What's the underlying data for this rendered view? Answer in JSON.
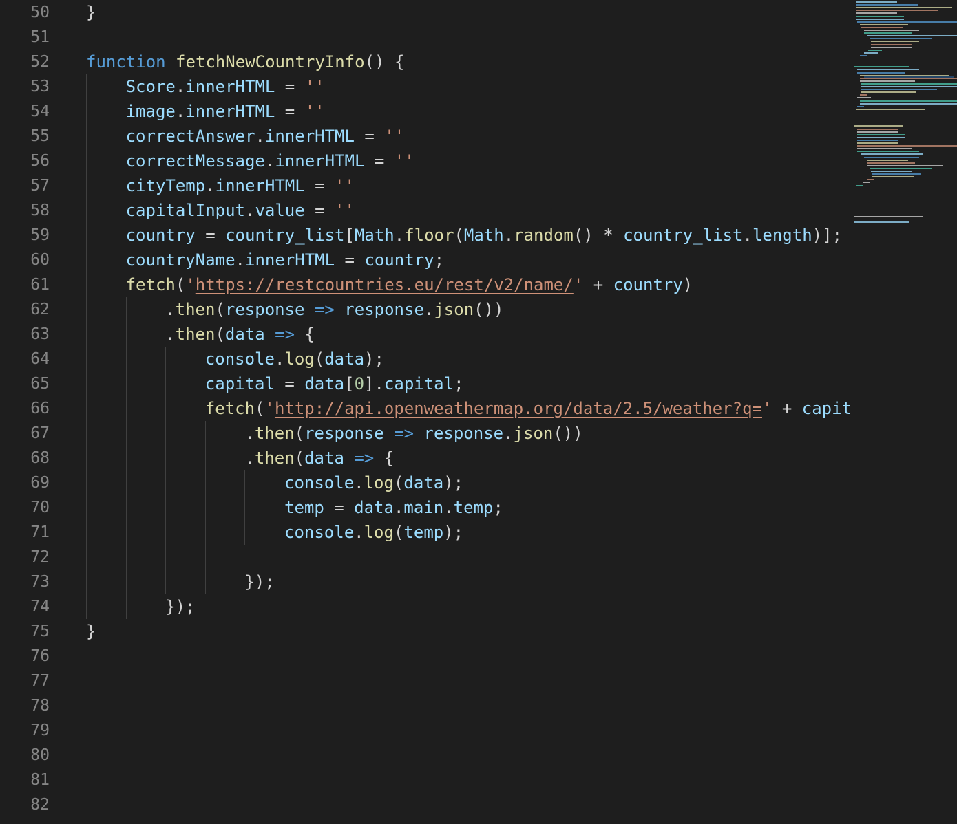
{
  "editor": {
    "colors": {
      "background": "#1e1e1e",
      "line_number": "#858585",
      "default": "#d4d4d4",
      "keyword": "#569cd6",
      "function": "#dcdcaa",
      "variable": "#9cdcfe",
      "string": "#ce9178",
      "number": "#b5cea8",
      "class": "#4ec9b0",
      "indent_guide": "#404040"
    },
    "lines": [
      {
        "number": "50",
        "indent": 0,
        "tokens": [
          {
            "t": "}",
            "c": "default"
          }
        ]
      },
      {
        "number": "51",
        "indent": 0,
        "tokens": []
      },
      {
        "number": "52",
        "indent": 0,
        "tokens": [
          {
            "t": "function",
            "c": "keyword"
          },
          {
            "t": " ",
            "c": "default"
          },
          {
            "t": "fetchNewCountryInfo",
            "c": "function"
          },
          {
            "t": "() {",
            "c": "default"
          }
        ]
      },
      {
        "number": "53",
        "indent": 1,
        "tokens": [
          {
            "t": "Score",
            "c": "variable"
          },
          {
            "t": ".",
            "c": "default"
          },
          {
            "t": "innerHTML",
            "c": "variable"
          },
          {
            "t": " = ",
            "c": "default"
          },
          {
            "t": "''",
            "c": "string"
          }
        ]
      },
      {
        "number": "54",
        "indent": 1,
        "tokens": [
          {
            "t": "image",
            "c": "variable"
          },
          {
            "t": ".",
            "c": "default"
          },
          {
            "t": "innerHTML",
            "c": "variable"
          },
          {
            "t": " = ",
            "c": "default"
          },
          {
            "t": "''",
            "c": "string"
          }
        ]
      },
      {
        "number": "55",
        "indent": 1,
        "tokens": [
          {
            "t": "correctAnswer",
            "c": "variable"
          },
          {
            "t": ".",
            "c": "default"
          },
          {
            "t": "innerHTML",
            "c": "variable"
          },
          {
            "t": " = ",
            "c": "default"
          },
          {
            "t": "''",
            "c": "string"
          }
        ]
      },
      {
        "number": "56",
        "indent": 1,
        "tokens": [
          {
            "t": "correctMessage",
            "c": "variable"
          },
          {
            "t": ".",
            "c": "default"
          },
          {
            "t": "innerHTML",
            "c": "variable"
          },
          {
            "t": " = ",
            "c": "default"
          },
          {
            "t": "''",
            "c": "string"
          }
        ]
      },
      {
        "number": "57",
        "indent": 1,
        "tokens": [
          {
            "t": "cityTemp",
            "c": "variable"
          },
          {
            "t": ".",
            "c": "default"
          },
          {
            "t": "innerHTML",
            "c": "variable"
          },
          {
            "t": " = ",
            "c": "default"
          },
          {
            "t": "''",
            "c": "string"
          }
        ]
      },
      {
        "number": "58",
        "indent": 1,
        "tokens": [
          {
            "t": "capitalInput",
            "c": "variable"
          },
          {
            "t": ".",
            "c": "default"
          },
          {
            "t": "value",
            "c": "variable"
          },
          {
            "t": " = ",
            "c": "default"
          },
          {
            "t": "''",
            "c": "string"
          }
        ]
      },
      {
        "number": "59",
        "indent": 1,
        "tokens": [
          {
            "t": "country",
            "c": "variable"
          },
          {
            "t": " = ",
            "c": "default"
          },
          {
            "t": "country_list",
            "c": "variable"
          },
          {
            "t": "[",
            "c": "default"
          },
          {
            "t": "Math",
            "c": "variable"
          },
          {
            "t": ".",
            "c": "default"
          },
          {
            "t": "floor",
            "c": "function"
          },
          {
            "t": "(",
            "c": "default"
          },
          {
            "t": "Math",
            "c": "variable"
          },
          {
            "t": ".",
            "c": "default"
          },
          {
            "t": "random",
            "c": "function"
          },
          {
            "t": "() * ",
            "c": "default"
          },
          {
            "t": "country_list",
            "c": "variable"
          },
          {
            "t": ".",
            "c": "default"
          },
          {
            "t": "length",
            "c": "variable"
          },
          {
            "t": ")];",
            "c": "default"
          }
        ]
      },
      {
        "number": "60",
        "indent": 1,
        "tokens": [
          {
            "t": "countryName",
            "c": "variable"
          },
          {
            "t": ".",
            "c": "default"
          },
          {
            "t": "innerHTML",
            "c": "variable"
          },
          {
            "t": " = ",
            "c": "default"
          },
          {
            "t": "country",
            "c": "variable"
          },
          {
            "t": ";",
            "c": "default"
          }
        ]
      },
      {
        "number": "61",
        "indent": 1,
        "tokens": [
          {
            "t": "fetch",
            "c": "function"
          },
          {
            "t": "(",
            "c": "default"
          },
          {
            "t": "'",
            "c": "string"
          },
          {
            "t": "https://restcountries.eu/rest/v2/name/",
            "c": "link"
          },
          {
            "t": "'",
            "c": "string"
          },
          {
            "t": " + ",
            "c": "default"
          },
          {
            "t": "country",
            "c": "variable"
          },
          {
            "t": ")",
            "c": "default"
          }
        ]
      },
      {
        "number": "62",
        "indent": 2,
        "tokens": [
          {
            "t": ".",
            "c": "default"
          },
          {
            "t": "then",
            "c": "function"
          },
          {
            "t": "(",
            "c": "default"
          },
          {
            "t": "response",
            "c": "variable"
          },
          {
            "t": " ",
            "c": "default"
          },
          {
            "t": "=>",
            "c": "keyword"
          },
          {
            "t": " ",
            "c": "default"
          },
          {
            "t": "response",
            "c": "variable"
          },
          {
            "t": ".",
            "c": "default"
          },
          {
            "t": "json",
            "c": "function"
          },
          {
            "t": "())",
            "c": "default"
          }
        ]
      },
      {
        "number": "63",
        "indent": 2,
        "tokens": [
          {
            "t": ".",
            "c": "default"
          },
          {
            "t": "then",
            "c": "function"
          },
          {
            "t": "(",
            "c": "default"
          },
          {
            "t": "data",
            "c": "variable"
          },
          {
            "t": " ",
            "c": "default"
          },
          {
            "t": "=>",
            "c": "keyword"
          },
          {
            "t": " {",
            "c": "default"
          }
        ]
      },
      {
        "number": "64",
        "indent": 3,
        "tokens": [
          {
            "t": "console",
            "c": "variable"
          },
          {
            "t": ".",
            "c": "default"
          },
          {
            "t": "log",
            "c": "function"
          },
          {
            "t": "(",
            "c": "default"
          },
          {
            "t": "data",
            "c": "variable"
          },
          {
            "t": ");",
            "c": "default"
          }
        ]
      },
      {
        "number": "65",
        "indent": 3,
        "tokens": [
          {
            "t": "capital",
            "c": "variable"
          },
          {
            "t": " = ",
            "c": "default"
          },
          {
            "t": "data",
            "c": "variable"
          },
          {
            "t": "[",
            "c": "default"
          },
          {
            "t": "0",
            "c": "number"
          },
          {
            "t": "].",
            "c": "default"
          },
          {
            "t": "capital",
            "c": "variable"
          },
          {
            "t": ";",
            "c": "default"
          }
        ]
      },
      {
        "number": "66",
        "indent": 3,
        "tokens": [
          {
            "t": "fetch",
            "c": "function"
          },
          {
            "t": "(",
            "c": "default"
          },
          {
            "t": "'",
            "c": "string"
          },
          {
            "t": "http://api.openweathermap.org/data/2.5/weather?q=",
            "c": "link"
          },
          {
            "t": "'",
            "c": "string"
          },
          {
            "t": " + ",
            "c": "default"
          },
          {
            "t": "capit",
            "c": "variable"
          }
        ]
      },
      {
        "number": "67",
        "indent": 4,
        "tokens": [
          {
            "t": ".",
            "c": "default"
          },
          {
            "t": "then",
            "c": "function"
          },
          {
            "t": "(",
            "c": "default"
          },
          {
            "t": "response",
            "c": "variable"
          },
          {
            "t": " ",
            "c": "default"
          },
          {
            "t": "=>",
            "c": "keyword"
          },
          {
            "t": " ",
            "c": "default"
          },
          {
            "t": "response",
            "c": "variable"
          },
          {
            "t": ".",
            "c": "default"
          },
          {
            "t": "json",
            "c": "function"
          },
          {
            "t": "())",
            "c": "default"
          }
        ]
      },
      {
        "number": "68",
        "indent": 4,
        "tokens": [
          {
            "t": ".",
            "c": "default"
          },
          {
            "t": "then",
            "c": "function"
          },
          {
            "t": "(",
            "c": "default"
          },
          {
            "t": "data",
            "c": "variable"
          },
          {
            "t": " ",
            "c": "default"
          },
          {
            "t": "=>",
            "c": "keyword"
          },
          {
            "t": " {",
            "c": "default"
          }
        ]
      },
      {
        "number": "69",
        "indent": 5,
        "tokens": [
          {
            "t": "console",
            "c": "variable"
          },
          {
            "t": ".",
            "c": "default"
          },
          {
            "t": "log",
            "c": "function"
          },
          {
            "t": "(",
            "c": "default"
          },
          {
            "t": "data",
            "c": "variable"
          },
          {
            "t": ");",
            "c": "default"
          }
        ]
      },
      {
        "number": "70",
        "indent": 5,
        "tokens": [
          {
            "t": "temp",
            "c": "variable"
          },
          {
            "t": " = ",
            "c": "default"
          },
          {
            "t": "data",
            "c": "variable"
          },
          {
            "t": ".",
            "c": "default"
          },
          {
            "t": "main",
            "c": "variable"
          },
          {
            "t": ".",
            "c": "default"
          },
          {
            "t": "temp",
            "c": "variable"
          },
          {
            "t": ";",
            "c": "default"
          }
        ]
      },
      {
        "number": "71",
        "indent": 5,
        "tokens": [
          {
            "t": "console",
            "c": "variable"
          },
          {
            "t": ".",
            "c": "default"
          },
          {
            "t": "log",
            "c": "function"
          },
          {
            "t": "(",
            "c": "default"
          },
          {
            "t": "temp",
            "c": "variable"
          },
          {
            "t": ");",
            "c": "default"
          }
        ]
      },
      {
        "number": "72",
        "indent": 0,
        "tokens": []
      },
      {
        "number": "73",
        "indent": 4,
        "tokens": [
          {
            "t": "});",
            "c": "default"
          }
        ]
      },
      {
        "number": "74",
        "indent": 2,
        "tokens": [
          {
            "t": "});",
            "c": "default"
          }
        ]
      },
      {
        "number": "75",
        "indent": 0,
        "tokens": [
          {
            "t": "}",
            "c": "default"
          }
        ]
      },
      {
        "number": "76",
        "indent": 0,
        "tokens": []
      },
      {
        "number": "77",
        "indent": 0,
        "tokens": []
      },
      {
        "number": "78",
        "indent": 0,
        "tokens": []
      },
      {
        "number": "79",
        "indent": 0,
        "tokens": []
      },
      {
        "number": "80",
        "indent": 0,
        "tokens": []
      },
      {
        "number": "81",
        "indent": 0,
        "tokens": []
      },
      {
        "number": "82",
        "indent": 0,
        "tokens": []
      }
    ]
  }
}
